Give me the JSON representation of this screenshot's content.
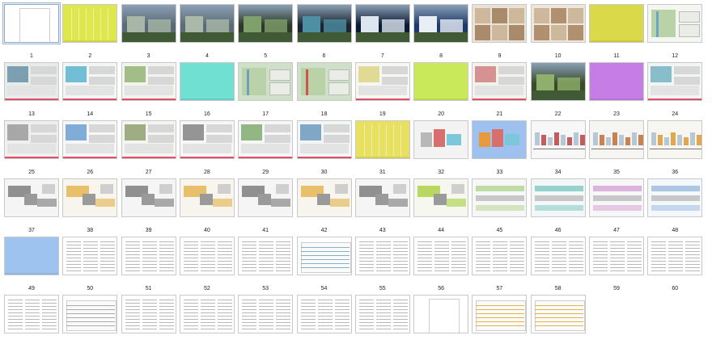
{
  "window": {
    "title": ""
  },
  "thumbnails": [
    {
      "label": "1",
      "kind": "blank",
      "selected": true
    },
    {
      "label": "2",
      "kind": "solid",
      "bg": "#dfe74e",
      "lines": true
    },
    {
      "label": "3",
      "kind": "render",
      "bg": "#5b6a76",
      "accent": "#a7b6a6"
    },
    {
      "label": "4",
      "kind": "render",
      "bg": "#5d6c74",
      "accent": "#aab9a9"
    },
    {
      "label": "5",
      "kind": "photo",
      "bg": "#2d3a2a",
      "accent": "#7fa06a"
    },
    {
      "label": "6",
      "kind": "photo",
      "bg": "#1a2530",
      "accent": "#4d8fa3"
    },
    {
      "label": "7",
      "kind": "photo",
      "bg": "#0d1a33",
      "accent": "#dce6f0"
    },
    {
      "label": "8",
      "kind": "photo",
      "bg": "#1e3a6a",
      "accent": "#e8eef5"
    },
    {
      "label": "9",
      "kind": "interiors",
      "bg": "#e9e2d6",
      "accent": "#a98a6b"
    },
    {
      "label": "10",
      "kind": "interiors",
      "bg": "#ece6dd",
      "accent": "#b0906e"
    },
    {
      "label": "11",
      "kind": "solid",
      "bg": "#d9d94a",
      "lines": false
    },
    {
      "label": "12",
      "kind": "plan",
      "bg": "#f4f6f2",
      "accent": "#6fa2c7"
    },
    {
      "label": "13",
      "kind": "panel",
      "bg": "#e6ece9",
      "accent": "#4f7f99"
    },
    {
      "label": "14",
      "kind": "panel",
      "bg": "#f3f6f7",
      "accent": "#3aa7c8"
    },
    {
      "label": "15",
      "kind": "panel",
      "bg": "#f4f4ef",
      "accent": "#7fa55b"
    },
    {
      "label": "16",
      "kind": "solid",
      "bg": "#6fe0d2",
      "lines": false
    },
    {
      "label": "17",
      "kind": "plan",
      "bg": "#cfe0c9",
      "accent": "#6f9ec0"
    },
    {
      "label": "18",
      "kind": "plan",
      "bg": "#cfe0c9",
      "accent": "#d0534b"
    },
    {
      "label": "19",
      "kind": "panel",
      "bg": "#f6f6f2",
      "accent": "#d9cf6d"
    },
    {
      "label": "20",
      "kind": "solid",
      "bg": "#c9e85a",
      "lines": false
    },
    {
      "label": "21",
      "kind": "panel",
      "bg": "#f4f2ec",
      "accent": "#c86a6a"
    },
    {
      "label": "22",
      "kind": "photo",
      "bg": "#3b4b2c",
      "accent": "#8fb06a"
    },
    {
      "label": "23",
      "kind": "solid",
      "bg": "#c77de6",
      "lines": false
    },
    {
      "label": "24",
      "kind": "panel",
      "bg": "#f1f5f6",
      "accent": "#5aa7b8"
    },
    {
      "label": "25",
      "kind": "panel",
      "bg": "#efefef",
      "accent": "#8a8a8a"
    },
    {
      "label": "26",
      "kind": "panel",
      "bg": "#f6f7f8",
      "accent": "#4f8cc9"
    },
    {
      "label": "27",
      "kind": "panel",
      "bg": "#f5f5f0",
      "accent": "#7a8f55"
    },
    {
      "label": "28",
      "kind": "panel",
      "bg": "#f7f7f7",
      "accent": "#6b6b6b"
    },
    {
      "label": "29",
      "kind": "panel",
      "bg": "#f6f7f5",
      "accent": "#6a9a55"
    },
    {
      "label": "30",
      "kind": "panel",
      "bg": "#f3f6f7",
      "accent": "#4f86b0"
    },
    {
      "label": "31",
      "kind": "solid",
      "bg": "#e8e060",
      "lines": true
    },
    {
      "label": "32",
      "kind": "massing",
      "bg": "#f3f3f3",
      "accent": "#b8b8b8"
    },
    {
      "label": "33",
      "kind": "massing",
      "bg": "#9fc1f0",
      "accent": "#e79a3b"
    },
    {
      "label": "34",
      "kind": "section",
      "bg": "#f7f7f7",
      "accent": "#c75a5a"
    },
    {
      "label": "35",
      "kind": "section",
      "bg": "#f7f5f2",
      "accent": "#c9824f"
    },
    {
      "label": "36",
      "kind": "section",
      "bg": "#f7f6f0",
      "accent": "#e3a64b"
    },
    {
      "label": "37",
      "kind": "floorplan",
      "bg": "#f5f5f5",
      "accent": "#777777"
    },
    {
      "label": "38",
      "kind": "floorplan",
      "bg": "#f7f5ee",
      "accent": "#e3b24a"
    },
    {
      "label": "39",
      "kind": "floorplan",
      "bg": "#f5f5f5",
      "accent": "#777777"
    },
    {
      "label": "40",
      "kind": "floorplan",
      "bg": "#f7f5ee",
      "accent": "#e3b24a"
    },
    {
      "label": "41",
      "kind": "floorplan",
      "bg": "#f5f5f5",
      "accent": "#777777"
    },
    {
      "label": "42",
      "kind": "floorplan",
      "bg": "#f7f5ee",
      "accent": "#e3b24a"
    },
    {
      "label": "43",
      "kind": "floorplan",
      "bg": "#f5f5f5",
      "accent": "#777777"
    },
    {
      "label": "44",
      "kind": "floorplan",
      "bg": "#f6f7ee",
      "accent": "#a9cf3d"
    },
    {
      "label": "45",
      "kind": "elevation",
      "bg": "#f7f7f7",
      "accent": "#9bc96f"
    },
    {
      "label": "46",
      "kind": "elevation",
      "bg": "#f3f7f7",
      "accent": "#57b7b0"
    },
    {
      "label": "47",
      "kind": "elevation",
      "bg": "#f7f7f7",
      "accent": "#c985c9"
    },
    {
      "label": "48",
      "kind": "elevation",
      "bg": "#f5f8fb",
      "accent": "#7aa6d6"
    },
    {
      "label": "49",
      "kind": "solid",
      "bg": "#9fc3ef",
      "lines": false
    },
    {
      "label": "50",
      "kind": "text",
      "bg": "#ffffff",
      "accent": "#aaaaaa"
    },
    {
      "label": "51",
      "kind": "text",
      "bg": "#ffffff",
      "accent": "#aaaaaa"
    },
    {
      "label": "52",
      "kind": "text",
      "bg": "#ffffff",
      "accent": "#aaaaaa"
    },
    {
      "label": "53",
      "kind": "text",
      "bg": "#ffffff",
      "accent": "#aaaaaa"
    },
    {
      "label": "54",
      "kind": "table",
      "bg": "#ffffff",
      "accent": "#8ab0c8"
    },
    {
      "label": "55",
      "kind": "text",
      "bg": "#ffffff",
      "accent": "#aaaaaa"
    },
    {
      "label": "56",
      "kind": "text",
      "bg": "#ffffff",
      "accent": "#aaaaaa"
    },
    {
      "label": "57",
      "kind": "text",
      "bg": "#ffffff",
      "accent": "#aaaaaa"
    },
    {
      "label": "58",
      "kind": "text",
      "bg": "#ffffff",
      "accent": "#aaaaaa"
    },
    {
      "label": "59",
      "kind": "text",
      "bg": "#ffffff",
      "accent": "#aaaaaa"
    },
    {
      "label": "60",
      "kind": "text",
      "bg": "#ffffff",
      "accent": "#aaaaaa"
    },
    {
      "label": "",
      "kind": "text",
      "bg": "#ffffff",
      "accent": "#aaaaaa"
    },
    {
      "label": "",
      "kind": "table",
      "bg": "#ffffff",
      "accent": "#aaaaaa"
    },
    {
      "label": "",
      "kind": "text",
      "bg": "#ffffff",
      "accent": "#aaaaaa"
    },
    {
      "label": "",
      "kind": "text",
      "bg": "#ffffff",
      "accent": "#aaaaaa"
    },
    {
      "label": "",
      "kind": "text",
      "bg": "#ffffff",
      "accent": "#aaaaaa"
    },
    {
      "label": "",
      "kind": "text",
      "bg": "#ffffff",
      "accent": "#aaaaaa"
    },
    {
      "label": "",
      "kind": "text",
      "bg": "#ffffff",
      "accent": "#aaaaaa"
    },
    {
      "label": "",
      "kind": "blank",
      "selected": false
    },
    {
      "label": "",
      "kind": "table",
      "bg": "#ffffff",
      "accent": "#e3b24a"
    },
    {
      "label": "",
      "kind": "table",
      "bg": "#ffffff",
      "accent": "#e3b24a"
    }
  ]
}
